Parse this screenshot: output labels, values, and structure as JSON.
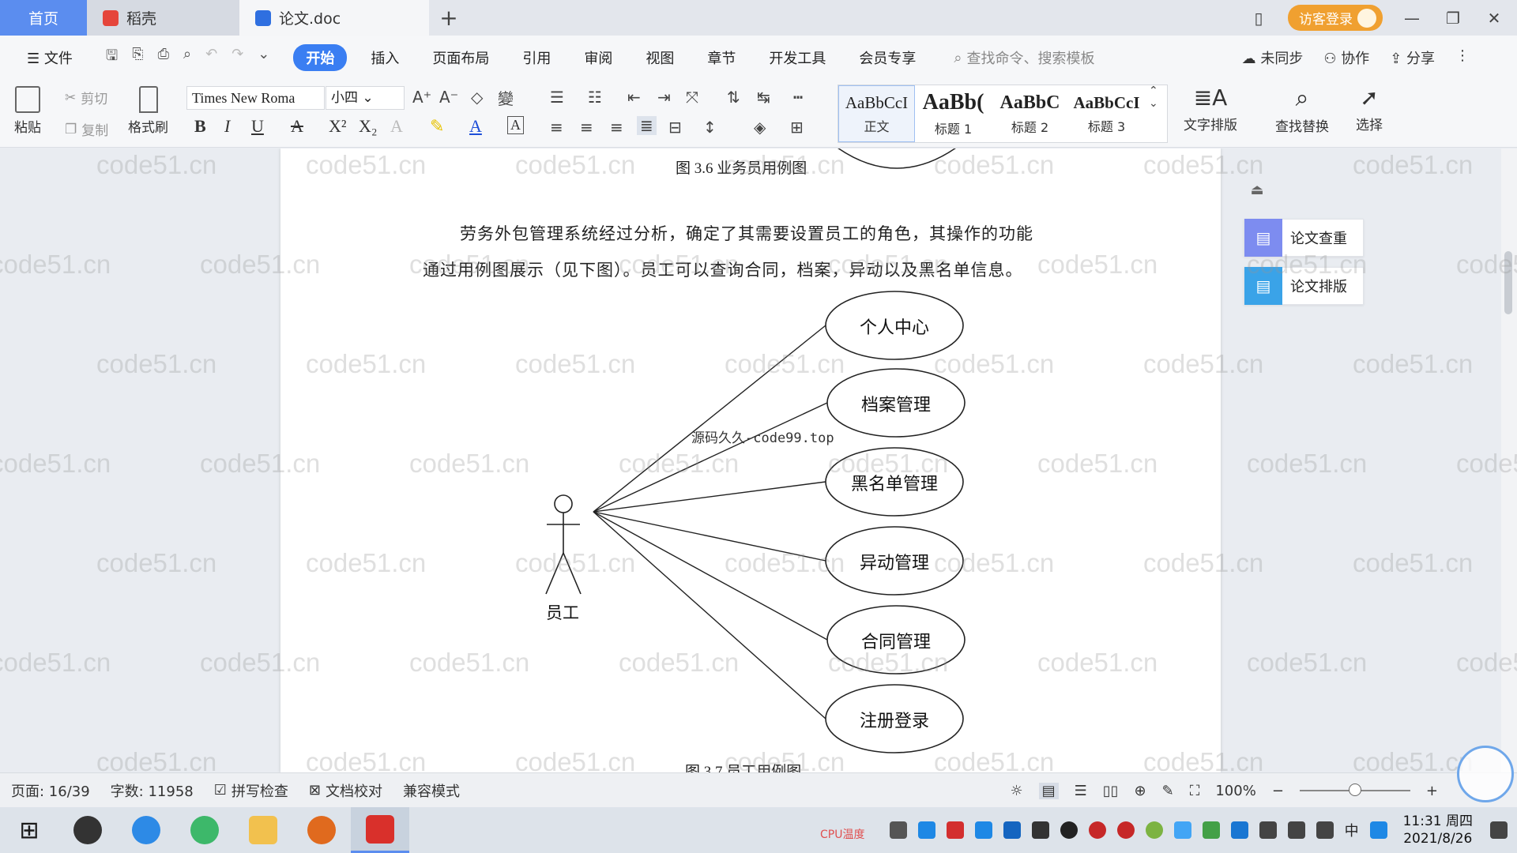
{
  "tabs": {
    "home": "首页",
    "daoke": "稻壳",
    "doc": "论文.doc",
    "visitor_login": "访客登录"
  },
  "menu": {
    "file": "文件",
    "items": [
      "开始",
      "插入",
      "页面布局",
      "引用",
      "审阅",
      "视图",
      "章节",
      "开发工具",
      "会员专享"
    ],
    "search_placeholder": "查找命令、搜索模板",
    "unsynced": "未同步",
    "collaborate": "协作",
    "share": "分享"
  },
  "ribbon": {
    "paste": "粘贴",
    "cut": "剪切",
    "copy": "复制",
    "format_painter": "格式刷",
    "font_name": "Times New Roma",
    "font_size": "小四",
    "styles": [
      {
        "sample": "AaBbCcI",
        "name": "正文"
      },
      {
        "sample": "AaBb(",
        "name": "标题 1"
      },
      {
        "sample": "AaBbC",
        "name": "标题 2"
      },
      {
        "sample": "AaBbCcI",
        "name": "标题 3"
      }
    ],
    "text_layout": "文字排版",
    "find_replace": "查找替换",
    "select": "选择"
  },
  "document": {
    "caption_top": "图 3.6  业务员用例图",
    "paragraph_line1": "劳务外包管理系统经过分析，确定了其需要设置员工的角色，其操作的功能",
    "paragraph_line2": "通过用例图展示（见下图）。员工可以查询合同，档案，异动以及黑名单信息。",
    "inner_watermark": "源码久久-code99.top",
    "actor": "员工",
    "use_cases": [
      "个人中心",
      "档案管理",
      "黑名单管理",
      "异动管理",
      "合同管理",
      "注册登录"
    ],
    "caption_bottom": "图 3.7  员工用例图"
  },
  "side_panel": {
    "check": "论文查重",
    "layout": "论文排版"
  },
  "status": {
    "page": "页面: 16/39",
    "words": "字数: 11958",
    "spell_check": "拼写检查",
    "doc_proof": "文档校对",
    "compat_mode": "兼容模式",
    "zoom": "100%",
    "zoom_fraction": 0.5
  },
  "taskbar": {
    "cpu": "CPU温度",
    "time": "11:31 周四",
    "date": "2021/8/26",
    "ime": "中"
  },
  "watermark_text": "code51.cn",
  "colors": {
    "accent": "#3a7ef2",
    "home_tab": "#5b8def",
    "visitor": "#f0a030"
  }
}
